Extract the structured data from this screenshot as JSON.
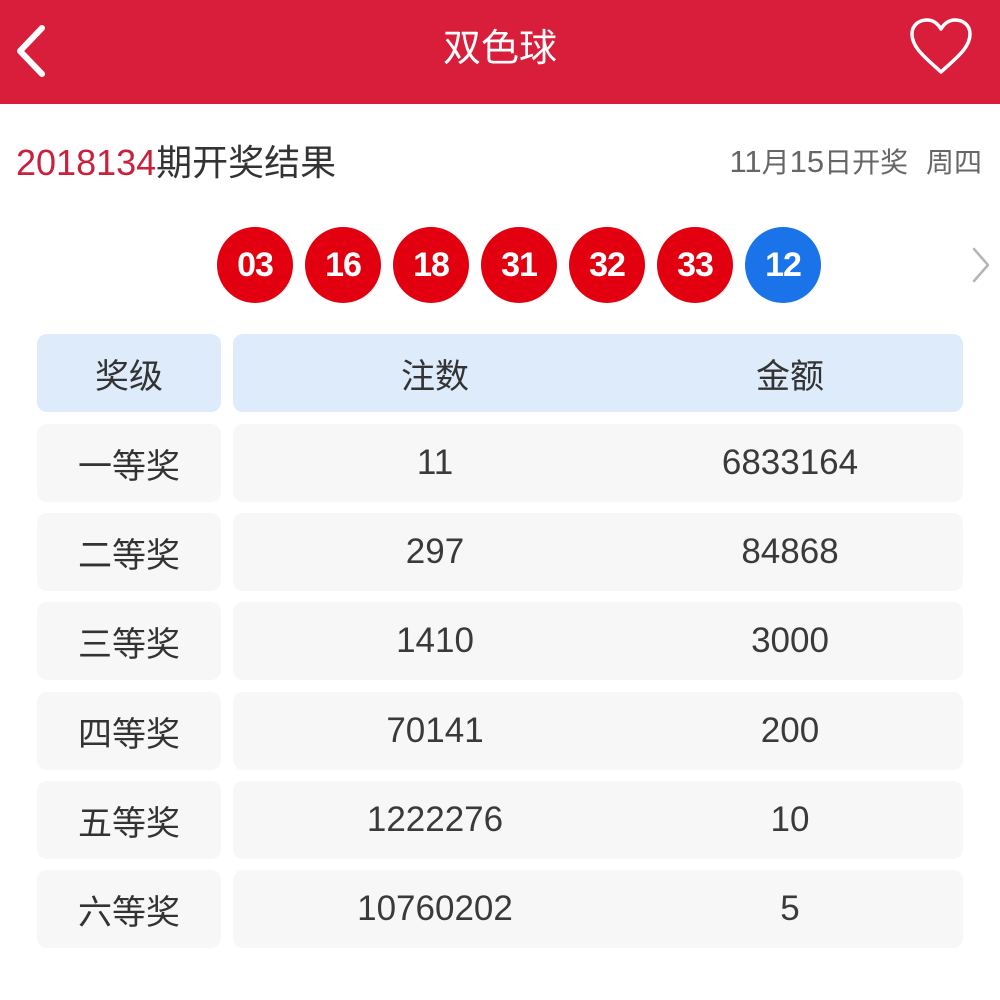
{
  "header": {
    "title": "双色球",
    "back_icon": "chevron-left-icon",
    "favorite_icon": "heart-outline-icon",
    "bg_color": "#d81e3a"
  },
  "draw": {
    "issue_number": "2018134",
    "issue_suffix": "期开奖结果",
    "date_month": "11",
    "date_month_label": "月",
    "date_day": "15",
    "date_day_label": "日开奖",
    "weekday": "周四",
    "red_balls": [
      "03",
      "16",
      "18",
      "31",
      "32",
      "33"
    ],
    "blue_ball": "12",
    "red_color": "#e20010",
    "blue_color": "#1a73e8",
    "more_icon": "chevron-right-icon"
  },
  "table": {
    "headers": [
      "奖级",
      "注数",
      "金额"
    ],
    "rows": [
      {
        "level": "一等奖",
        "count": "11",
        "amount": "6833164"
      },
      {
        "level": "二等奖",
        "count": "297",
        "amount": "84868"
      },
      {
        "level": "三等奖",
        "count": "1410",
        "amount": "3000"
      },
      {
        "level": "四等奖",
        "count": "70141",
        "amount": "200"
      },
      {
        "level": "五等奖",
        "count": "1222276",
        "amount": "10"
      },
      {
        "level": "六等奖",
        "count": "10760202",
        "amount": "5"
      }
    ]
  }
}
